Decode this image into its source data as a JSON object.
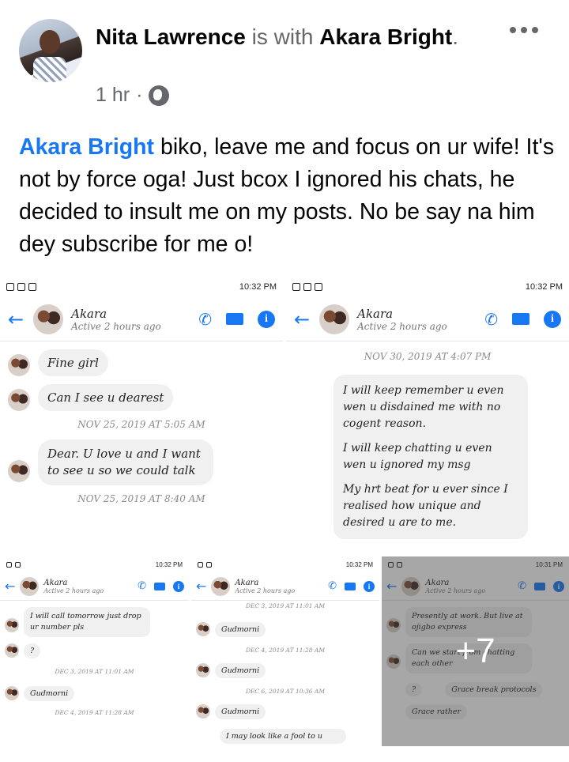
{
  "post": {
    "author": "Nita Lawrence",
    "with_word": "is with",
    "tagged": "Akara Bright",
    "time": "1 hr",
    "mention": "Akara Bright",
    "body": "biko, leave me and focus on ur wife! It's not by force oga! Just bcox I ignored his chats, he decided to insult me on my posts. No be say na him dey subscribe for me o!"
  },
  "chat": {
    "name": "Akara",
    "status": "Active 2 hours ago",
    "shot1": {
      "time": "10:32 PM",
      "m1": "Fine girl",
      "m2": "Can I see u dearest",
      "ts1": "NOV 25, 2019 AT 5:05 AM",
      "m3": "Dear. U love u and I want to see u so we could talk",
      "ts2": "NOV 25, 2019 AT 8:40 AM"
    },
    "shot2": {
      "time": "10:32 PM",
      "ts1": "NOV 30, 2019 AT 4:07 PM",
      "p1": "I will keep remember u even wen u disdained me with no cogent reason.",
      "p2": "I will keep chatting u even wen u ignored my msg",
      "p3": "My hrt beat for u ever since I realised how unique and desired u are to me."
    },
    "shot3": {
      "time": "10:32 PM",
      "m1": "I will call tomorrow just drop ur number pls",
      "m2": "?",
      "ts1": "DEC 3, 2019 AT 11:01 AM",
      "m3": "Gudmorni",
      "ts2": "DEC 4, 2019 AT 11:28 AM"
    },
    "shot4": {
      "time": "10:32 PM",
      "ts0": "DEC 3, 2019 AT 11:01 AM",
      "m1": "Gudmorni",
      "ts1": "DEC 4, 2019 AT 11:28 AM",
      "m2": "Gudmorni",
      "ts2": "DEC 6, 2019 AT 10:36 AM",
      "m3": "Gudmorni",
      "m4": "I may look like a fool to u"
    },
    "shot5": {
      "time": "10:31 PM",
      "m1": "Presently at work. But live at ojigbo express",
      "m2": "Can we start from chatting each other",
      "m3": "?",
      "m4": "Grace break protocols",
      "m5": "Grace rather"
    }
  },
  "more_count": "+7",
  "colors": {
    "link": "#1877f2",
    "bubble": "#f0f0f0"
  }
}
